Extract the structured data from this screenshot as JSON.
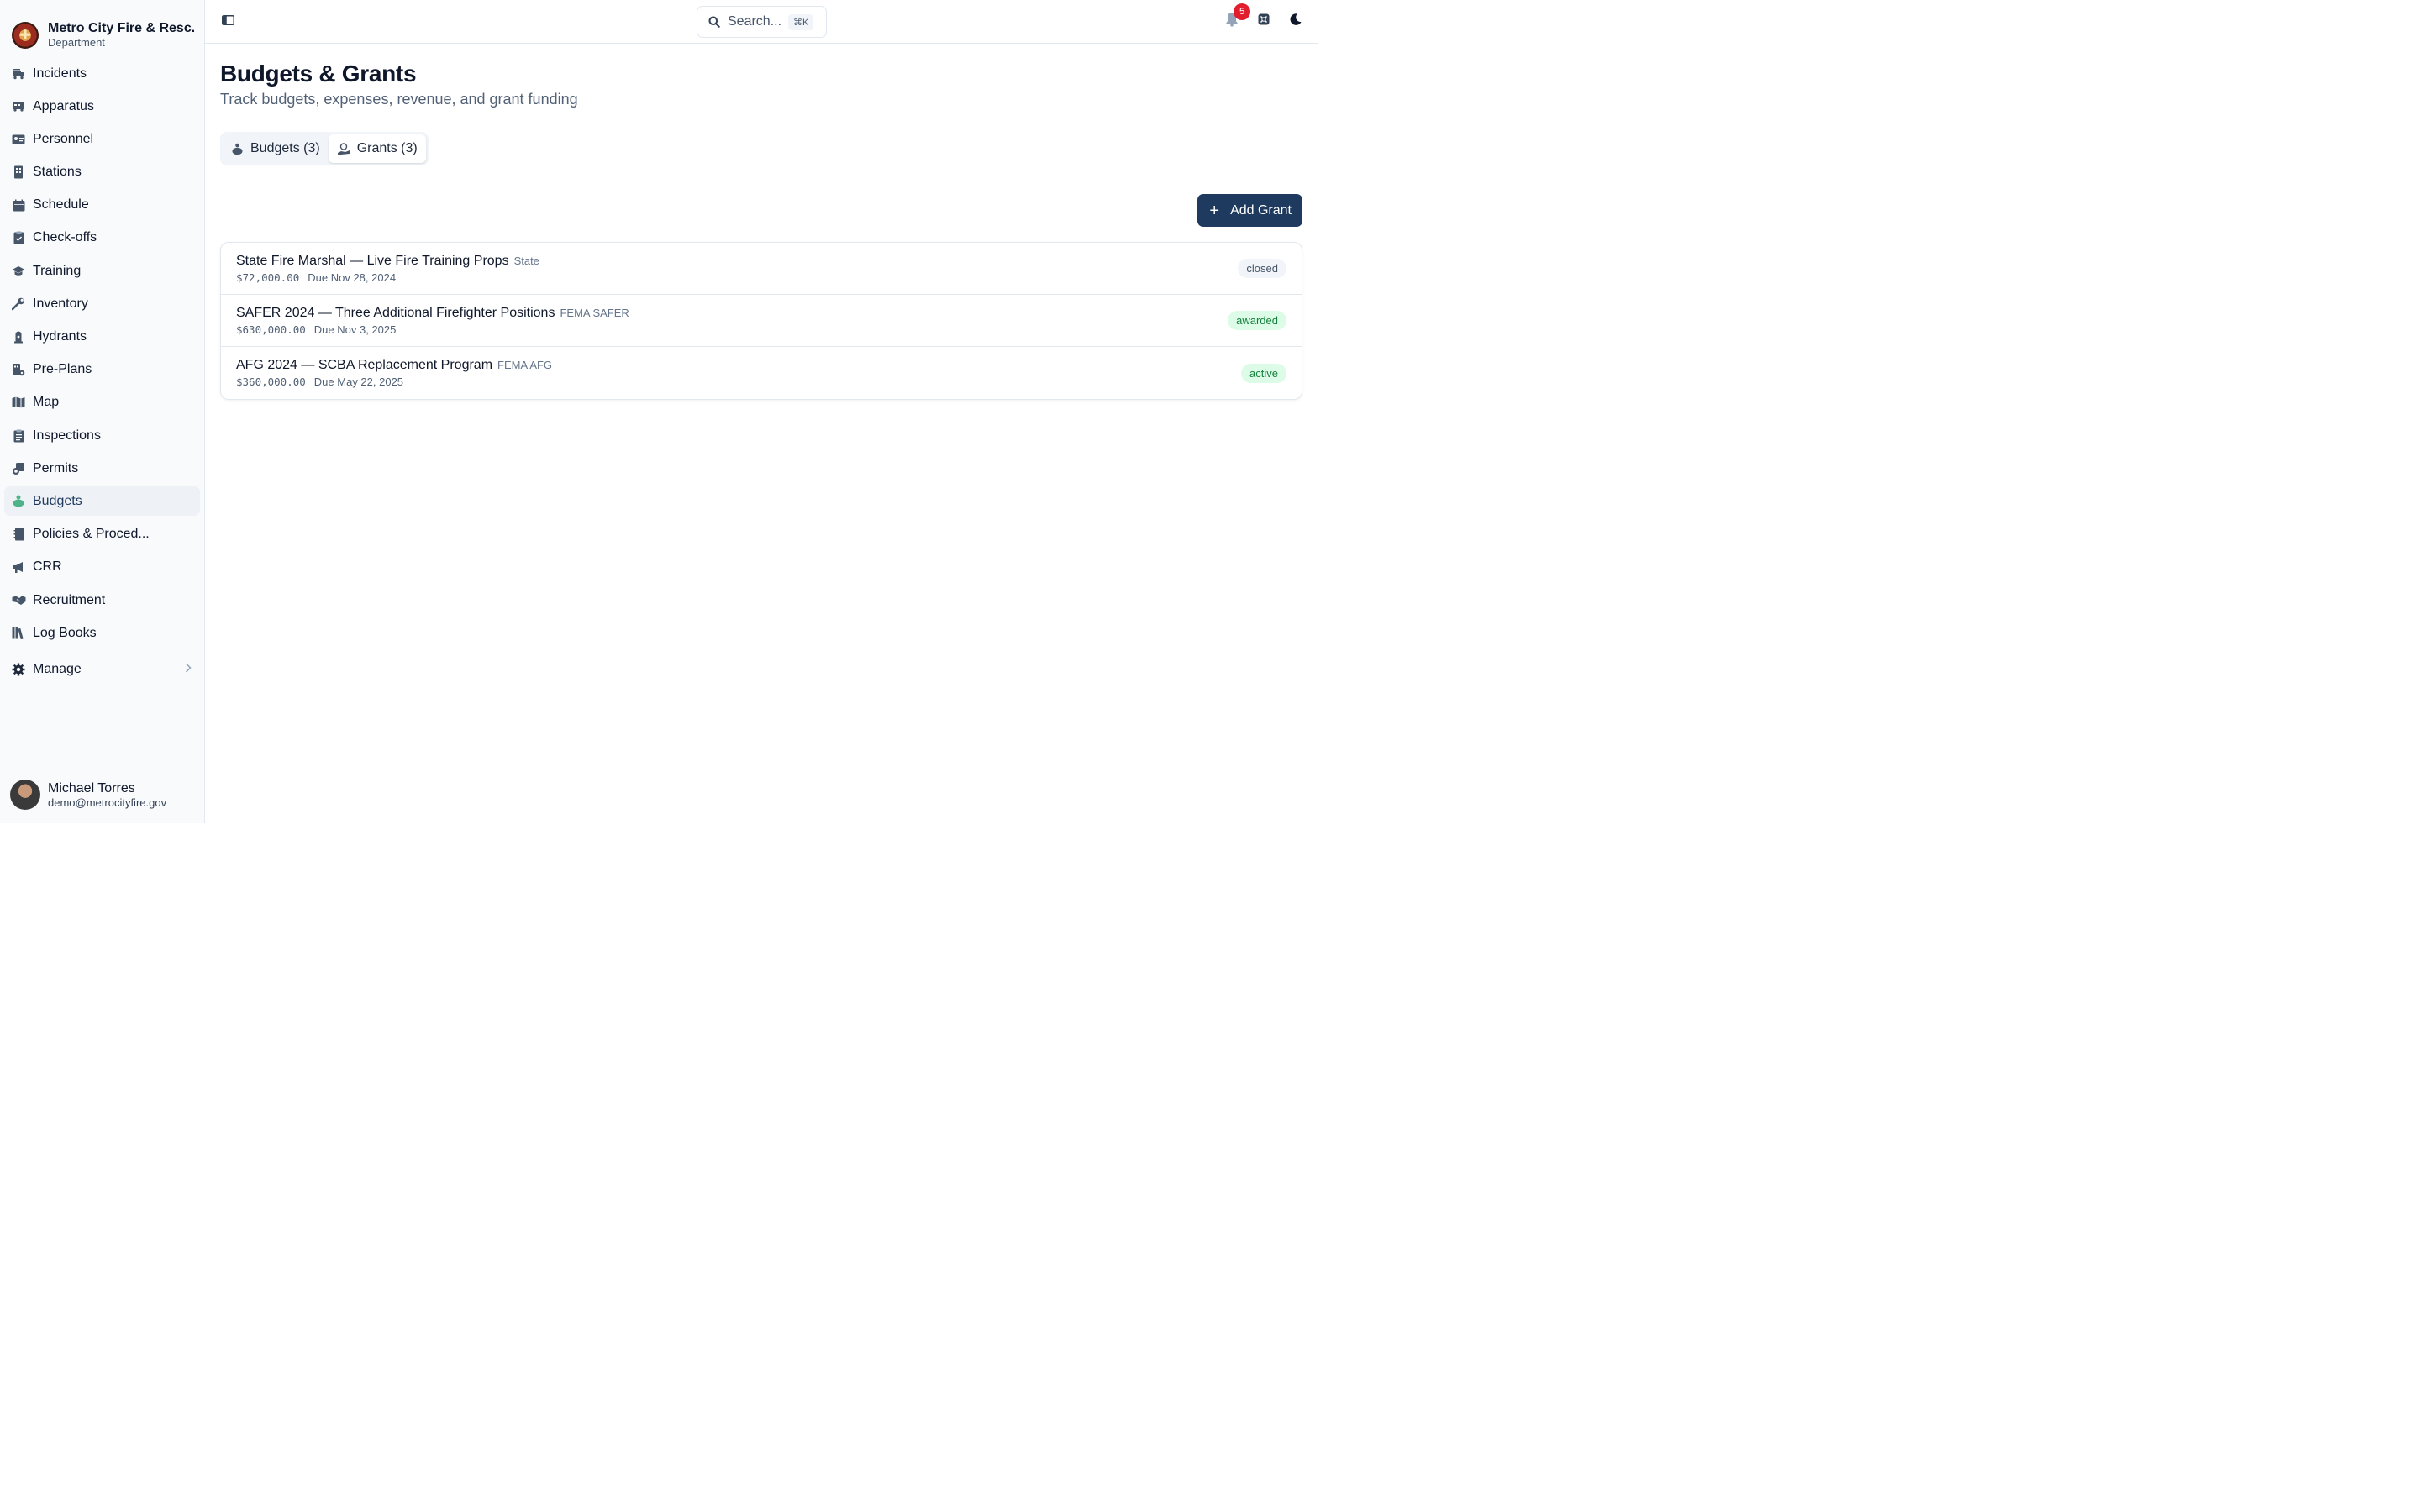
{
  "org": {
    "name": "Metro City Fire & Resc...",
    "sub": "Department"
  },
  "nav": [
    {
      "label": "Incidents",
      "icon": "fire-truck-icon"
    },
    {
      "label": "Apparatus",
      "icon": "truck-icon"
    },
    {
      "label": "Personnel",
      "icon": "id-card-icon"
    },
    {
      "label": "Stations",
      "icon": "building-icon"
    },
    {
      "label": "Schedule",
      "icon": "calendar-icon"
    },
    {
      "label": "Check-offs",
      "icon": "clipboard-check-icon"
    },
    {
      "label": "Training",
      "icon": "graduation-cap-icon"
    },
    {
      "label": "Inventory",
      "icon": "wrench-icon"
    },
    {
      "label": "Hydrants",
      "icon": "hydrant-icon"
    },
    {
      "label": "Pre-Plans",
      "icon": "building-plan-icon"
    },
    {
      "label": "Map",
      "icon": "map-icon"
    },
    {
      "label": "Inspections",
      "icon": "clipboard-list-icon"
    },
    {
      "label": "Permits",
      "icon": "stamp-icon"
    },
    {
      "label": "Budgets",
      "icon": "piggy-bank-icon",
      "active": true
    },
    {
      "label": "Policies & Proced...",
      "icon": "book-icon"
    },
    {
      "label": "CRR",
      "icon": "megaphone-icon"
    },
    {
      "label": "Recruitment",
      "icon": "handshake-icon"
    },
    {
      "label": "Log Books",
      "icon": "books-icon"
    }
  ],
  "manage": {
    "label": "Manage"
  },
  "user": {
    "name": "Michael Torres",
    "email": "demo@metrocityfire.gov"
  },
  "topbar": {
    "search_placeholder": "Search...",
    "search_kbd": "⌘K",
    "notification_count": "5"
  },
  "page": {
    "title": "Budgets & Grants",
    "subtitle": "Track budgets, expenses, revenue, and grant funding"
  },
  "tabs": [
    {
      "label": "Budgets (3)",
      "active": false
    },
    {
      "label": "Grants (3)",
      "active": true
    }
  ],
  "add_button": "Add Grant",
  "grants": [
    {
      "title": "State Fire Marshal — Live Fire Training Props",
      "tag": "State",
      "amount": "$72,000.00",
      "due": "Due Nov 28, 2024",
      "status": "closed"
    },
    {
      "title": "SAFER 2024 — Three Additional Firefighter Positions",
      "tag": "FEMA SAFER",
      "amount": "$630,000.00",
      "due": "Due Nov 3, 2025",
      "status": "awarded"
    },
    {
      "title": "AFG 2024 — SCBA Replacement Program",
      "tag": "FEMA AFG",
      "amount": "$360,000.00",
      "due": "Due May 22, 2025",
      "status": "active"
    }
  ],
  "colors": {
    "primary": "#1e3a5f",
    "active_nav_bg": "#eef2f6",
    "badge": "#e11d2e",
    "awarded_bg": "#dcfce7",
    "awarded_text": "#15803d"
  }
}
